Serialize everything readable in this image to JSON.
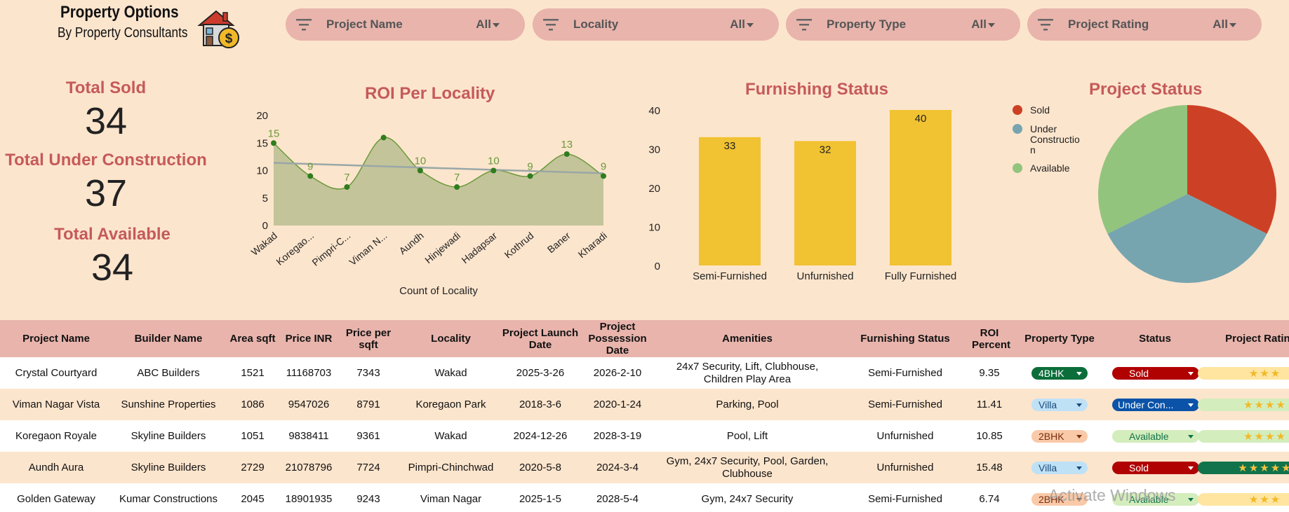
{
  "header": {
    "title": "Property Options",
    "subtitle": "By Property Consultants",
    "logo_icon": "house-money-icon"
  },
  "filters": [
    {
      "label": "Project Name",
      "value": "All"
    },
    {
      "label": "Locality",
      "value": "All"
    },
    {
      "label": "Property Type",
      "value": "All"
    },
    {
      "label": "Project Rating",
      "value": "All"
    }
  ],
  "kpis": {
    "sold_label": "Total Sold",
    "sold_value": "34",
    "uc_label": "Total Under Construction",
    "uc_value": "37",
    "available_label": "Total Available",
    "available_value": "34"
  },
  "chart_data": [
    {
      "type": "area",
      "title": "ROI Per Locality",
      "xlabel": "Count of Locality",
      "ylabel": "",
      "categories": [
        "Wakad",
        "Koregao...",
        "Pimpri-C...",
        "Viman N...",
        "Aundh",
        "Hinjewadi",
        "Hadapsar",
        "Kothrud",
        "Baner",
        "Kharadi"
      ],
      "values": [
        15,
        9,
        7,
        16,
        10,
        7,
        10,
        9,
        13,
        9
      ],
      "data_labels": [
        "15",
        "9",
        "7",
        "",
        "10",
        "7",
        "10",
        "9",
        "13",
        "9"
      ],
      "ylim": [
        0,
        20
      ],
      "yticks": [
        "0",
        "5",
        "10",
        "15",
        "20"
      ],
      "trendline": [
        11.4,
        9.5
      ],
      "colors": {
        "fill": "#c4c49a",
        "line": "#6a9a3a",
        "point": "#2e7d1e",
        "trend": "#9aa7a7"
      },
      "legend": "none"
    },
    {
      "type": "bar",
      "title": "Furnishing Status",
      "categories": [
        "Semi-Furnished",
        "Unfurnished",
        "Fully Furnished"
      ],
      "values": [
        33,
        32,
        40
      ],
      "ylim": [
        0,
        40
      ],
      "yticks": [
        "0",
        "10",
        "20",
        "30",
        "40"
      ],
      "colors": {
        "bar": "#f1c232"
      },
      "legend": "none"
    },
    {
      "type": "pie",
      "title": "Project Status",
      "labels": [
        "Sold",
        "Under Construction",
        "Available"
      ],
      "legend_labels": [
        "Sold",
        "Under Constructio n",
        "Available"
      ],
      "values": [
        34,
        37,
        34
      ],
      "colors": [
        "#cc4125",
        "#76a5af",
        "#93c47d"
      ],
      "legend": "left"
    }
  ],
  "table": {
    "headers": [
      "Project Name",
      "Builder Name",
      "Area sqft",
      "Price INR",
      "Price per sqft",
      "Locality",
      "Project Launch Date",
      "Project Possession Date",
      "Amenities",
      "Furnishing Status",
      "ROI Percent",
      "Property Type",
      "Status",
      "Project Rating"
    ],
    "rows": [
      {
        "project": "Crystal Courtyard",
        "builder": "ABC Builders",
        "area": "1521",
        "price": "11168703",
        "ppsf": "7343",
        "locality": "Wakad",
        "launch": "2025-3-26",
        "possession": "2026-2-10",
        "amenities": "24x7 Security, Lift, Clubhouse, Children Play Area",
        "furnishing": "Semi-Furnished",
        "roi": "9.35",
        "type": "4BHK",
        "status": "Sold",
        "rating": 3
      },
      {
        "project": "Viman Nagar Vista",
        "builder": "Sunshine Properties",
        "area": "1086",
        "price": "9547026",
        "ppsf": "8791",
        "locality": "Koregaon Park",
        "launch": "2018-3-6",
        "possession": "2020-1-24",
        "amenities": "Parking, Pool",
        "furnishing": "Semi-Furnished",
        "roi": "11.41",
        "type": "Villa",
        "status": "Under Con...",
        "rating": 4
      },
      {
        "project": "Koregaon Royale",
        "builder": "Skyline Builders",
        "area": "1051",
        "price": "9838411",
        "ppsf": "9361",
        "locality": "Wakad",
        "launch": "2024-12-26",
        "possession": "2028-3-19",
        "amenities": "Pool, Lift",
        "furnishing": "Unfurnished",
        "roi": "10.85",
        "type": "2BHK",
        "status": "Available",
        "rating": 4
      },
      {
        "project": "Aundh Aura",
        "builder": "Skyline Builders",
        "area": "2729",
        "price": "21078796",
        "ppsf": "7724",
        "locality": "Pimpri-Chinchwad",
        "launch": "2020-5-8",
        "possession": "2024-3-4",
        "amenities": "Gym, 24x7 Security, Pool, Garden, Clubhouse",
        "furnishing": "Unfurnished",
        "roi": "15.48",
        "type": "Villa",
        "status": "Sold",
        "rating": 5
      },
      {
        "project": "Golden Gateway",
        "builder": "Kumar Constructions",
        "area": "2045",
        "price": "18901935",
        "ppsf": "9243",
        "locality": "Viman Nagar",
        "launch": "2025-1-5",
        "possession": "2028-5-4",
        "amenities": "Gym, 24x7 Security",
        "furnishing": "Semi-Furnished",
        "roi": "6.74",
        "type": "2BHK",
        "status": "Available",
        "rating": 3
      }
    ]
  },
  "watermark": "Activate Windows"
}
